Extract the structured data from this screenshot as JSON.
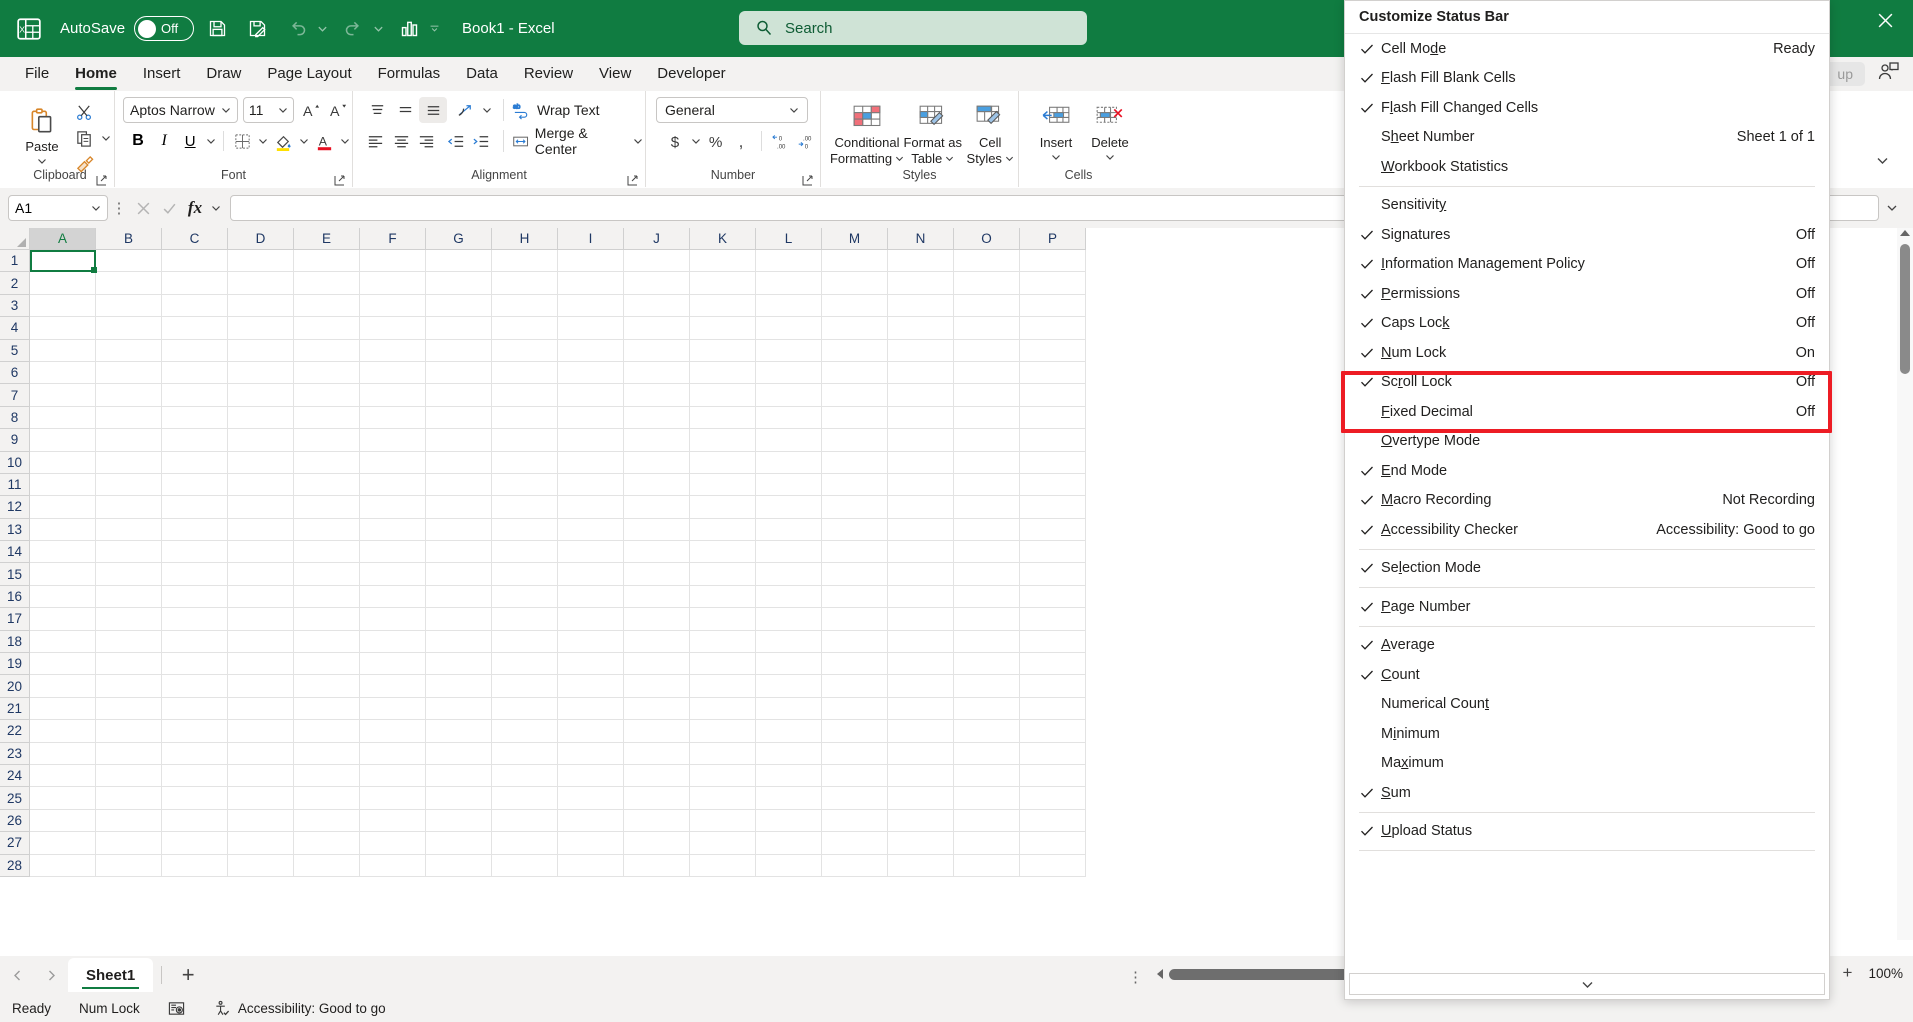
{
  "titlebar": {
    "autosave_label": "AutoSave",
    "autosave_state": "Off",
    "document_title": "Book1 - Excel",
    "quick_access": [
      "save-icon",
      "save-as-icon",
      "undo-icon",
      "redo-icon",
      "chart-icon",
      "customize-qat-icon"
    ]
  },
  "search": {
    "placeholder": "Search",
    "icon": "search-icon"
  },
  "ribbon_tabs": [
    {
      "label": "File",
      "active": false
    },
    {
      "label": "Home",
      "active": true
    },
    {
      "label": "Insert",
      "active": false
    },
    {
      "label": "Draw",
      "active": false
    },
    {
      "label": "Page Layout",
      "active": false
    },
    {
      "label": "Formulas",
      "active": false
    },
    {
      "label": "Data",
      "active": false
    },
    {
      "label": "Review",
      "active": false
    },
    {
      "label": "View",
      "active": false
    },
    {
      "label": "Developer",
      "active": false
    }
  ],
  "ribbon_right": {
    "group_label": "up",
    "share_icon": "share-person-icon"
  },
  "ribbon": {
    "clipboard": {
      "label": "Clipboard",
      "paste": "Paste",
      "cut_icon": "scissors-icon",
      "copy_icon": "copy-icon",
      "format_painter_icon": "format-painter-icon"
    },
    "font": {
      "label": "Font",
      "font_name": "Aptos Narrow",
      "font_size": "11",
      "grow_icon": "increase-font-size-icon",
      "shrink_icon": "decrease-font-size-icon",
      "bold": "B",
      "italic": "I",
      "underline": "U",
      "borders_icon": "borders-icon",
      "fill_icon": "fill-color-icon",
      "fontcolor_icon": "font-color-icon"
    },
    "alignment": {
      "label": "Alignment",
      "wrap_text": "Wrap Text",
      "merge_center": "Merge & Center",
      "top_align_icon": "align-top-icon",
      "middle_align_icon": "align-middle-icon",
      "bottom_align_icon": "align-bottom-icon",
      "orientation_icon": "text-orientation-icon",
      "align_left_icon": "align-left-icon",
      "align_center_icon": "align-center-icon",
      "align_right_icon": "align-right-icon",
      "decrease_indent_icon": "decrease-indent-icon",
      "increase_indent_icon": "increase-indent-icon"
    },
    "number": {
      "label": "Number",
      "format": "General",
      "currency_icon": "currency-icon",
      "percent_icon": "percent-icon",
      "comma_icon": "comma-style-icon",
      "increase_decimal_icon": "increase-decimal-icon",
      "decrease_decimal_icon": "decrease-decimal-icon"
    },
    "styles": {
      "label": "Styles",
      "conditional_formatting": "Conditional\nFormatting",
      "conditional_formatting_l1": "Conditional",
      "conditional_formatting_l2": "Formatting",
      "format_as_table_l1": "Format as",
      "format_as_table_l2": "Table",
      "cell_styles_l1": "Cell",
      "cell_styles_l2": "Styles"
    },
    "cells": {
      "label": "Cells",
      "insert": "Insert",
      "delete": "Delete"
    }
  },
  "formula_bar": {
    "name_box": "A1",
    "cancel_icon": "cancel-icon",
    "enter_icon": "confirm-icon",
    "fx": "fx",
    "value": "",
    "expand_icon": "expand-formula-bar-icon"
  },
  "grid": {
    "columns": [
      "A",
      "B",
      "C",
      "D",
      "E",
      "F",
      "G",
      "H",
      "I",
      "J",
      "K",
      "L",
      "M",
      "N",
      "O",
      "P"
    ],
    "rows": [
      "1",
      "2",
      "3",
      "4",
      "5",
      "6",
      "7",
      "8",
      "9",
      "10",
      "11",
      "12",
      "13",
      "14",
      "15",
      "16",
      "17",
      "18",
      "19",
      "20",
      "21",
      "22",
      "23",
      "24",
      "25",
      "26",
      "27",
      "28"
    ],
    "active_cell": "A1"
  },
  "sheet_tabs": {
    "prev_icon": "previous-sheet-icon",
    "next_icon": "next-sheet-icon",
    "tabs": [
      "Sheet1"
    ],
    "add_label": "+"
  },
  "zoom_controls": {
    "zoom_out": "−",
    "zoom_in": "+",
    "level": "100%"
  },
  "status_bar": {
    "mode": "Ready",
    "num_lock": "Num Lock",
    "macro_icon": "record-macro-icon",
    "accessibility_icon": "accessibility-icon",
    "accessibility": "Accessibility: Good to go"
  },
  "context_menu": {
    "title": "Customize Status Bar",
    "scroll_down_icon": "chevron-down-icon",
    "highlight_color": "#ED1C24",
    "items": [
      {
        "label": "Cell Mode",
        "accel": "d",
        "checked": true,
        "value": "Ready",
        "sep_after": false
      },
      {
        "label": "Flash Fill Blank Cells",
        "accel": "F",
        "checked": true,
        "value": "",
        "sep_after": false
      },
      {
        "label": "Flash Fill Changed Cells",
        "accel": "l",
        "checked": true,
        "value": "",
        "sep_after": false
      },
      {
        "label": "Sheet Number",
        "accel": "h",
        "checked": false,
        "value": "Sheet 1 of 1",
        "sep_after": false
      },
      {
        "label": "Workbook Statistics",
        "accel": "W",
        "checked": false,
        "value": "",
        "sep_after": true
      },
      {
        "label": "Sensitivity",
        "accel": "y",
        "checked": false,
        "value": "",
        "sep_after": false
      },
      {
        "label": "Signatures",
        "accel": "g",
        "checked": true,
        "value": "Off",
        "sep_after": false
      },
      {
        "label": "Information Management Policy",
        "accel": "I",
        "checked": true,
        "value": "Off",
        "sep_after": false
      },
      {
        "label": "Permissions",
        "accel": "P",
        "checked": true,
        "value": "Off",
        "sep_after": false
      },
      {
        "label": "Caps Lock",
        "accel": "k",
        "checked": true,
        "value": "Off",
        "sep_after": false,
        "highlighted": true
      },
      {
        "label": "Num Lock",
        "accel": "N",
        "checked": true,
        "value": "On",
        "sep_after": false,
        "highlighted": true
      },
      {
        "label": "Scroll Lock",
        "accel": "r",
        "checked": true,
        "value": "Off",
        "sep_after": false
      },
      {
        "label": "Fixed Decimal",
        "accel": "F",
        "checked": false,
        "value": "Off",
        "sep_after": false
      },
      {
        "label": "Overtype Mode",
        "accel": "O",
        "checked": false,
        "value": "",
        "sep_after": false
      },
      {
        "label": "End Mode",
        "accel": "E",
        "checked": true,
        "value": "",
        "sep_after": false
      },
      {
        "label": "Macro Recording",
        "accel": "M",
        "checked": true,
        "value": "Not Recording",
        "sep_after": false
      },
      {
        "label": "Accessibility Checker",
        "accel": "A",
        "checked": true,
        "value": "Accessibility: Good to go",
        "sep_after": true
      },
      {
        "label": "Selection Mode",
        "accel": "l",
        "checked": true,
        "value": "",
        "sep_after": true
      },
      {
        "label": "Page Number",
        "accel": "P",
        "checked": true,
        "value": "",
        "sep_after": true
      },
      {
        "label": "Average",
        "accel": "A",
        "checked": true,
        "value": "",
        "sep_after": false
      },
      {
        "label": "Count",
        "accel": "C",
        "checked": true,
        "value": "",
        "sep_after": false
      },
      {
        "label": "Numerical Count",
        "accel": "t",
        "checked": false,
        "value": "",
        "sep_after": false
      },
      {
        "label": "Minimum",
        "accel": "i",
        "checked": false,
        "value": "",
        "sep_after": false
      },
      {
        "label": "Maximum",
        "accel": "x",
        "checked": false,
        "value": "",
        "sep_after": false
      },
      {
        "label": "Sum",
        "accel": "S",
        "checked": true,
        "value": "",
        "sep_after": true
      },
      {
        "label": "Upload Status",
        "accel": "U",
        "checked": true,
        "value": "",
        "sep_after": true
      }
    ]
  }
}
